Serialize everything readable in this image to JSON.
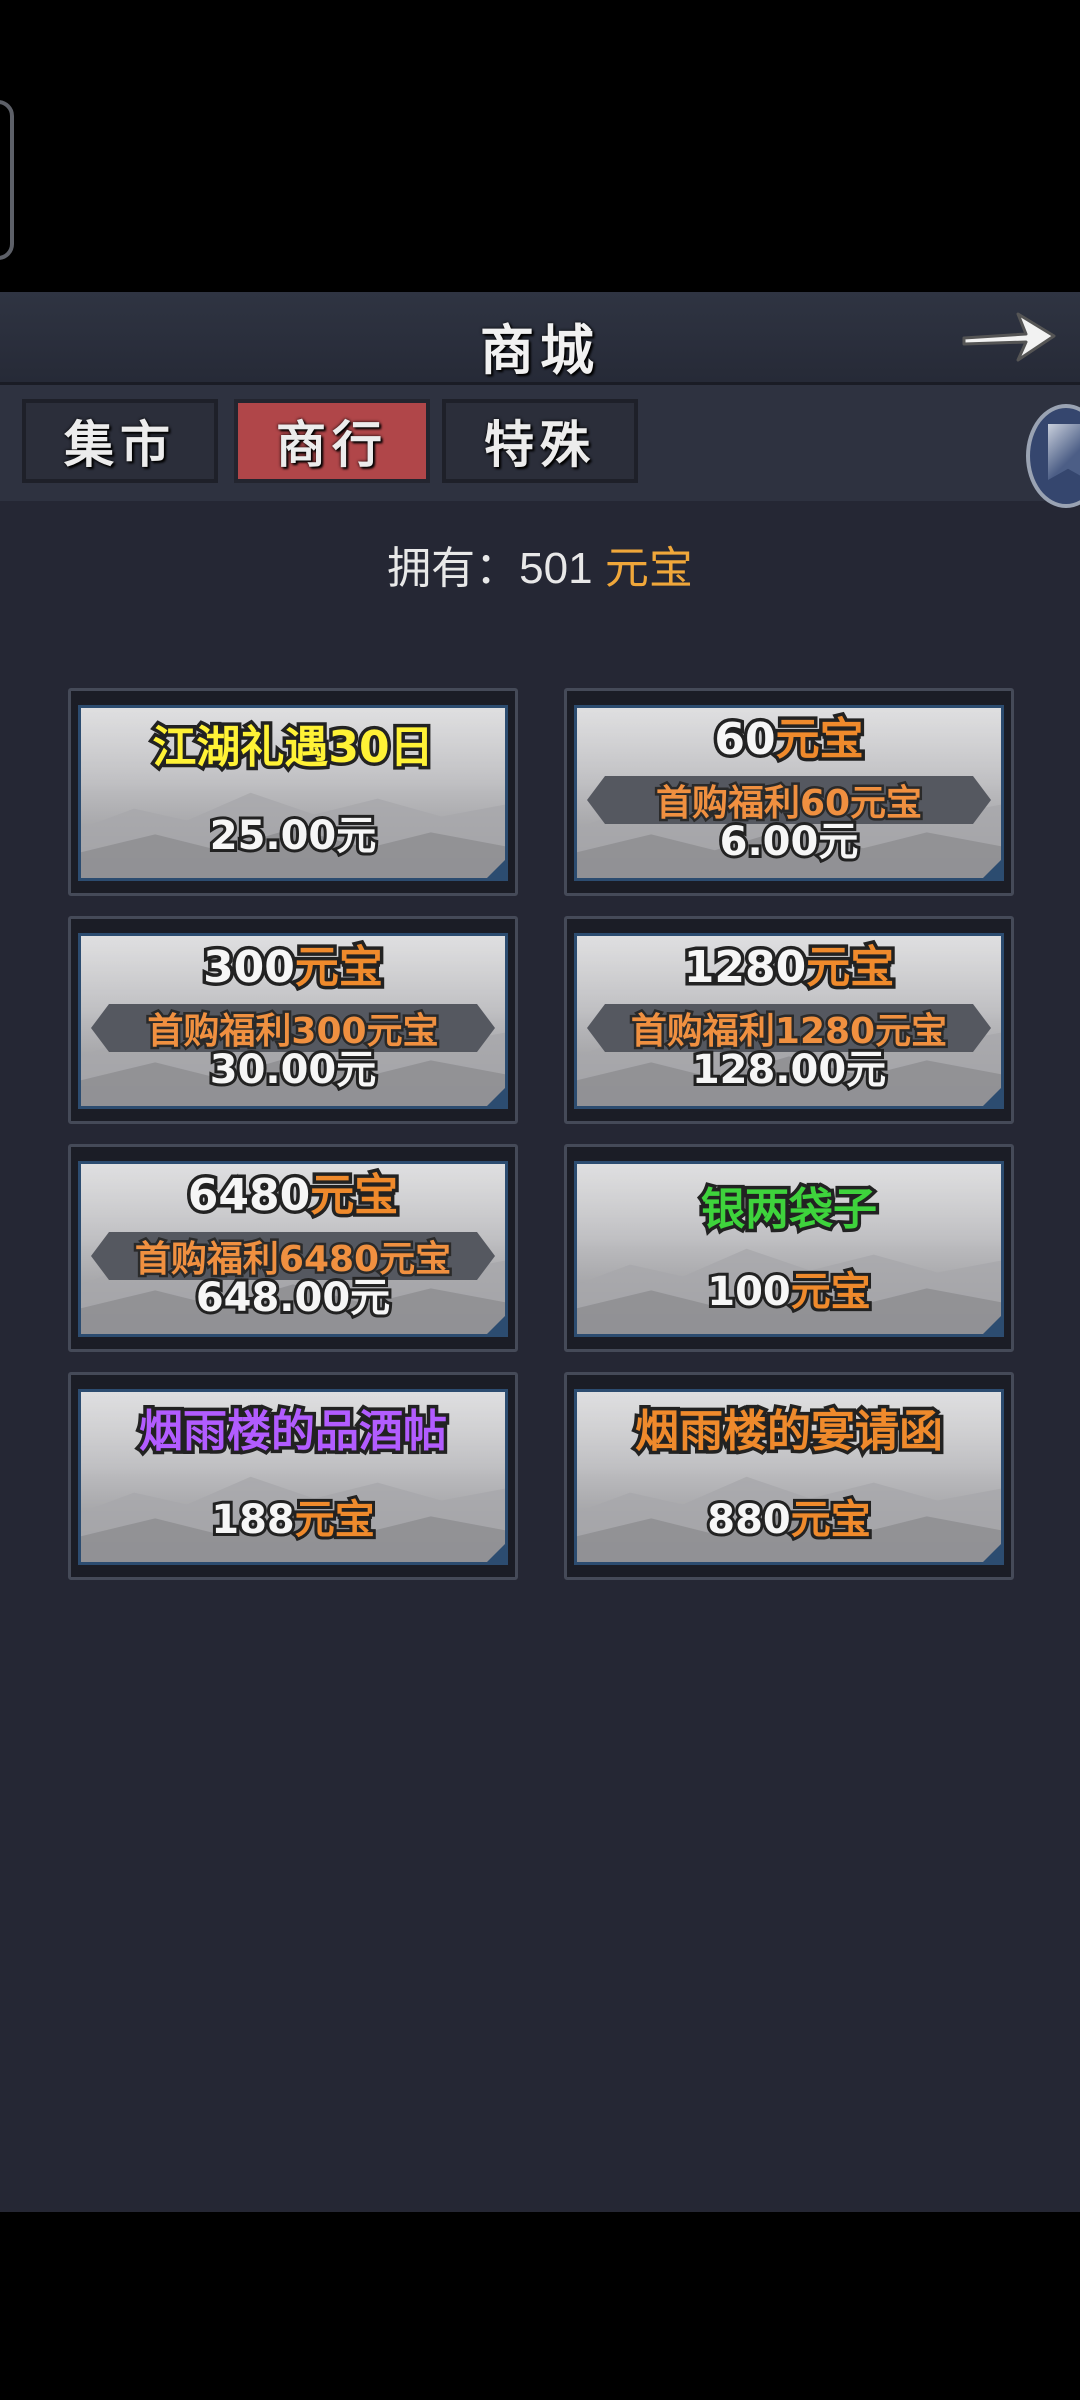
{
  "header": {
    "title": "商城"
  },
  "tabs": [
    {
      "label": "集市",
      "active": false
    },
    {
      "label": "商行",
      "active": true
    },
    {
      "label": "特殊",
      "active": false
    }
  ],
  "balance": {
    "label": "拥有：",
    "amount": "501",
    "currency": "元宝"
  },
  "cards": [
    {
      "name": "江湖礼遇30日",
      "price": "25.00元"
    },
    {
      "amount": "60",
      "unit": "元宝",
      "bonus": "首购福利60元宝",
      "price": "6.00元"
    },
    {
      "amount": "300",
      "unit": "元宝",
      "bonus": "首购福利300元宝",
      "price": "30.00元"
    },
    {
      "amount": "1280",
      "unit": "元宝",
      "bonus": "首购福利1280元宝",
      "price": "128.00元"
    },
    {
      "amount": "6480",
      "unit": "元宝",
      "bonus": "首购福利6480元宝",
      "price": "648.00元"
    },
    {
      "name": "银两袋子",
      "price_num": "100",
      "price_unit": "元宝"
    },
    {
      "name": "烟雨楼的品酒帖",
      "price_num": "188",
      "price_unit": "元宝"
    },
    {
      "name": "烟雨楼的宴请函",
      "price_num": "880",
      "price_unit": "元宝"
    }
  ],
  "colors": {
    "background": "#252734",
    "active_tab": "#b04649",
    "gold": "#f0a73a",
    "yellow_name": "#fff236",
    "green_name": "#3ed33c",
    "purple_name": "#b25cff",
    "orange_name": "#ef8a2c"
  },
  "icons": [
    "back-arrow-icon",
    "side-badge-icon"
  ]
}
